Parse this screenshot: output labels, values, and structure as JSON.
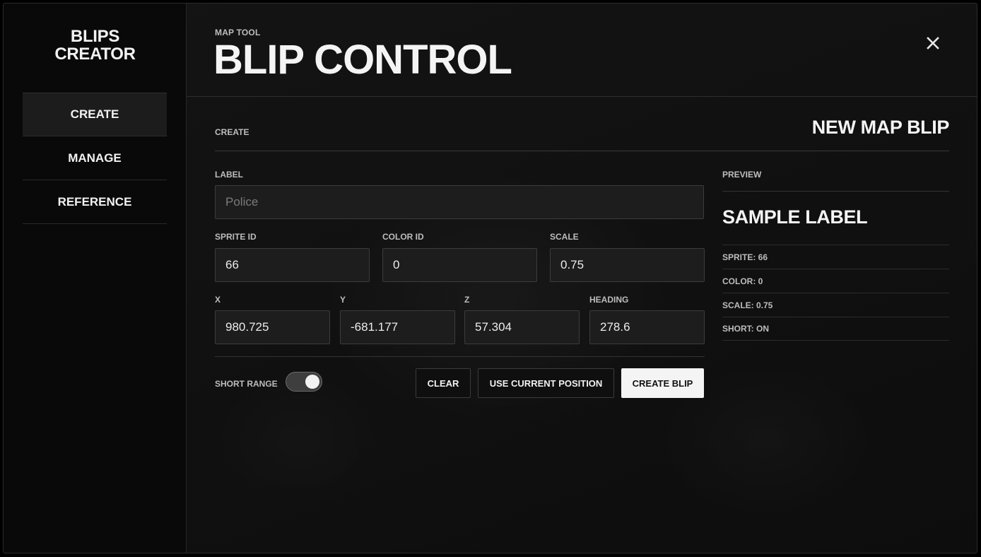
{
  "sidebar": {
    "brand_line1": "BLIPS",
    "brand_line2": "CREATOR",
    "items": [
      {
        "label": "CREATE",
        "active": true
      },
      {
        "label": "MANAGE",
        "active": false
      },
      {
        "label": "REFERENCE",
        "active": false
      }
    ]
  },
  "header": {
    "eyebrow": "MAP TOOL",
    "title": "BLIP CONTROL",
    "close_icon": "close-icon"
  },
  "section": {
    "label": "CREATE",
    "title": "NEW MAP BLIP"
  },
  "form": {
    "label": {
      "label": "LABEL",
      "value": "",
      "placeholder": "Police"
    },
    "sprite_id": {
      "label": "SPRITE ID",
      "value": "66"
    },
    "color_id": {
      "label": "COLOR ID",
      "value": "0"
    },
    "scale": {
      "label": "SCALE",
      "value": "0.75"
    },
    "x": {
      "label": "X",
      "value": "980.725"
    },
    "y": {
      "label": "Y",
      "value": "-681.177"
    },
    "z": {
      "label": "Z",
      "value": "57.304"
    },
    "heading": {
      "label": "HEADING",
      "value": "278.6"
    },
    "short_range": {
      "label": "SHORT RANGE",
      "enabled": true
    }
  },
  "buttons": {
    "clear": "CLEAR",
    "use_current_position": "USE CURRENT POSITION",
    "create_blip": "CREATE BLIP"
  },
  "preview": {
    "label": "PREVIEW",
    "name": "SAMPLE LABEL",
    "rows": [
      "SPRITE: 66",
      "COLOR: 0",
      "SCALE: 0.75",
      "SHORT: ON"
    ]
  },
  "colors": {
    "background": "#111111",
    "sidebar": "#090909",
    "primary_button": "#f4f4f4"
  }
}
